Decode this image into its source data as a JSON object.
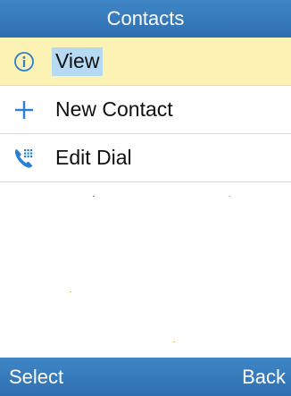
{
  "header": {
    "title": "Contacts"
  },
  "menu": {
    "items": [
      {
        "label": "View",
        "icon": "info-icon",
        "selected": true
      },
      {
        "label": "New Contact",
        "icon": "plus-icon",
        "selected": false
      },
      {
        "label": "Edit Dial",
        "icon": "phone-dialpad-icon",
        "selected": false
      }
    ]
  },
  "softkeys": {
    "left": "Select",
    "right": "Back"
  },
  "colors": {
    "bar": "#2f6fb0",
    "selected_row": "#fbf2b3",
    "selected_label": "#b6daf4",
    "icon": "#2a7fd4"
  }
}
